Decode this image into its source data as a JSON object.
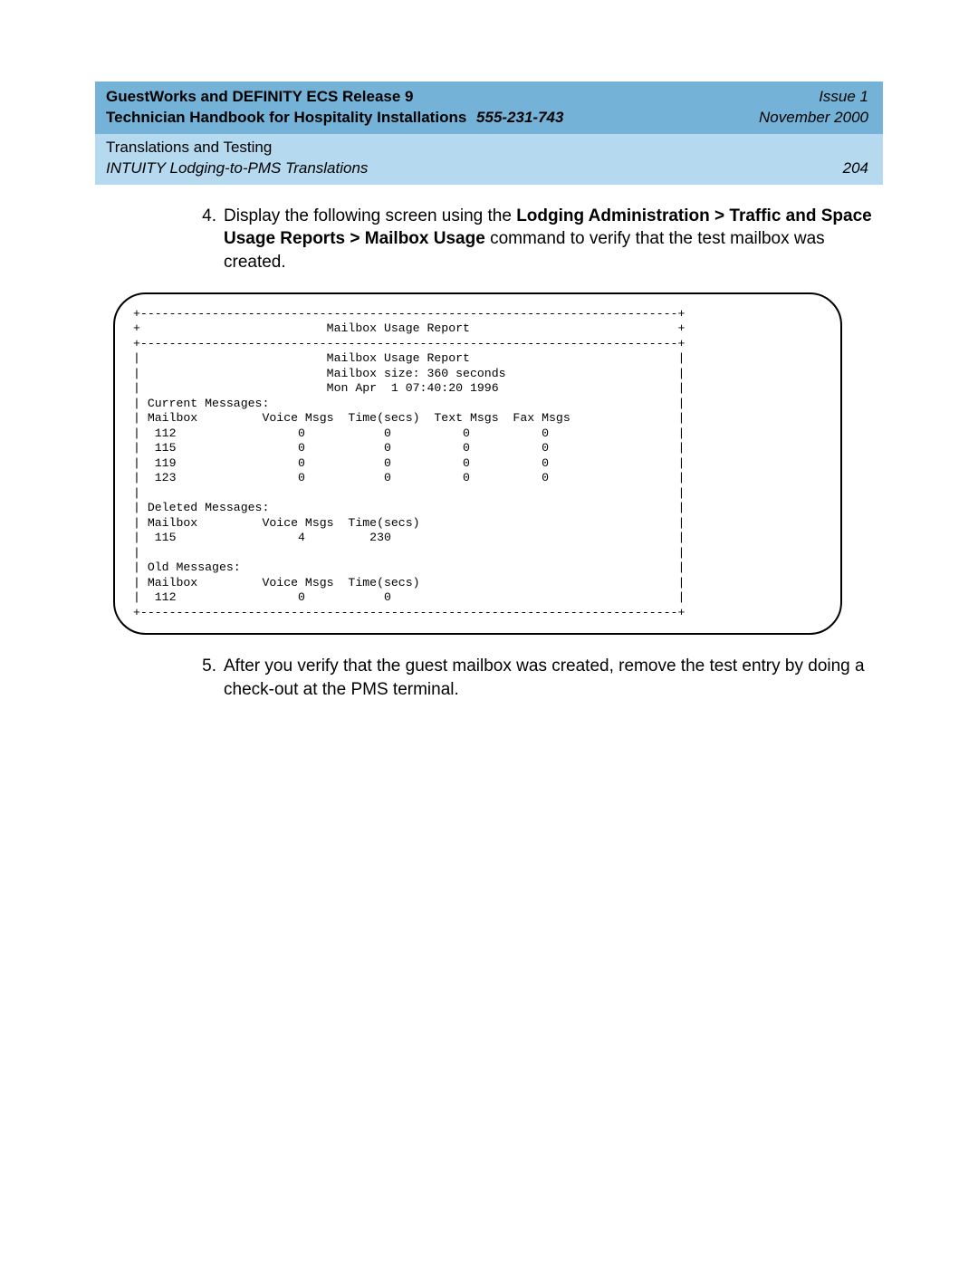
{
  "header": {
    "title_line1": "GuestWorks and DEFINITY ECS Release 9",
    "title_line2_a": "Technician Handbook for Hospitality Installations",
    "title_line2_docnum": "555-231-743",
    "issue": "Issue 1",
    "date": "November 2000"
  },
  "subheader": {
    "line1": "Translations and Testing",
    "line2": "INTUITY Lodging-to-PMS Translations",
    "page": "204"
  },
  "step4": {
    "num": "4.",
    "pre": "Display the following screen using the ",
    "bold": "Lodging Administration > Traffic and Space Usage Reports > Mailbox Usage",
    "post": " command to verify that the test mailbox was created."
  },
  "step5": {
    "num": "5.",
    "text": "After you verify that the guest mailbox was created, remove the test entry by doing a check-out at the PMS terminal."
  },
  "terminal": "+---------------------------------------------------------------------------+\n+                          Mailbox Usage Report                             +\n+---------------------------------------------------------------------------+\n|                          Mailbox Usage Report                             |\n|                          Mailbox size: 360 seconds                        |\n|                          Mon Apr  1 07:40:20 1996                         |\n| Current Messages:                                                         |\n| Mailbox         Voice Msgs  Time(secs)  Text Msgs  Fax Msgs               |\n|  112                 0           0          0          0                  |\n|  115                 0           0          0          0                  |\n|  119                 0           0          0          0                  |\n|  123                 0           0          0          0                  |\n|                                                                           |\n| Deleted Messages:                                                         |\n| Mailbox         Voice Msgs  Time(secs)                                    |\n|  115                 4         230                                        |\n|                                                                           |\n| Old Messages:                                                             |\n| Mailbox         Voice Msgs  Time(secs)                                    |\n|  112                 0           0                                        |\n+---------------------------------------------------------------------------+"
}
